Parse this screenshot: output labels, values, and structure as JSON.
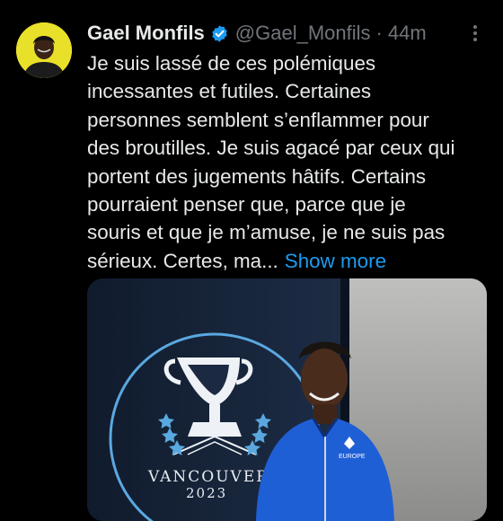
{
  "tweet": {
    "author_name": "Gael Monfils",
    "handle": "@Gael_Monfils",
    "separator": "·",
    "time": "44m",
    "lines": [
      "Je suis lassé de ces polémiques",
      "incessantes et futiles. Certaines",
      "personnes semblent s’enflammer pour",
      "des broutilles. Je suis agacé par ceux qui",
      "portent des jugements hâtifs. Certains",
      "pourraient penser que, parce que je",
      "souris et que je m’amuse, je ne suis pas"
    ],
    "last_line": "sérieux. Certes, ma...",
    "show_more": "Show more"
  },
  "media": {
    "logo_city": "VANCOUVER",
    "logo_year": "2023",
    "shirt_text": "EUROPE"
  },
  "icons": {
    "verified": "verified-badge-icon",
    "more": "more-options-icon"
  },
  "colors": {
    "background": "#000000",
    "text": "#e7e9ea",
    "muted": "#71767b",
    "link": "#1d9bf0",
    "avatar_bg": "#e9e02a",
    "jersey": "#1f5fd6"
  }
}
